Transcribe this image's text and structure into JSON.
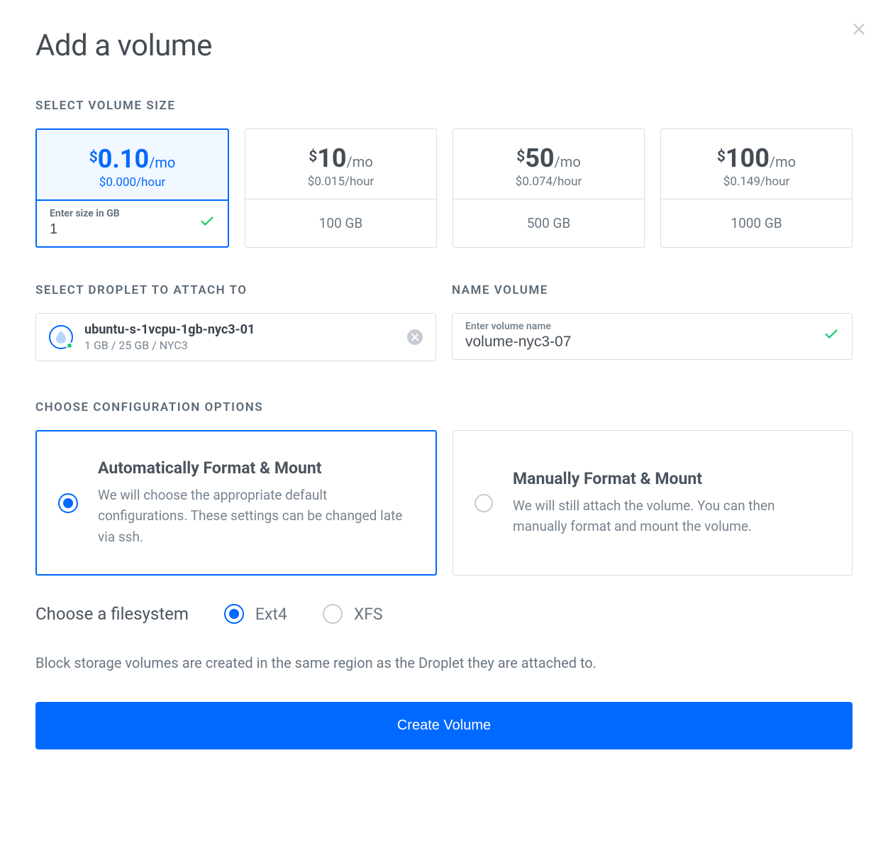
{
  "title": "Add a volume",
  "sections": {
    "size": "SELECT VOLUME SIZE",
    "droplet": "SELECT DROPLET TO ATTACH TO",
    "name": "NAME VOLUME",
    "config": "CHOOSE CONFIGURATION OPTIONS"
  },
  "sizes": [
    {
      "currency": "$",
      "amount": "0.10",
      "permo": "/mo",
      "sub": "$0.000/hour",
      "custom": true,
      "input_label": "Enter size in GB",
      "input_value": "1"
    },
    {
      "currency": "$",
      "amount": "10",
      "permo": "/mo",
      "sub": "$0.015/hour",
      "size": "100 GB"
    },
    {
      "currency": "$",
      "amount": "50",
      "permo": "/mo",
      "sub": "$0.074/hour",
      "size": "500 GB"
    },
    {
      "currency": "$",
      "amount": "100",
      "permo": "/mo",
      "sub": "$0.149/hour",
      "size": "1000 GB"
    }
  ],
  "droplet": {
    "name": "ubuntu-s-1vcpu-1gb-nyc3-01",
    "meta": "1 GB / 25 GB / NYC3"
  },
  "volume_name": {
    "label": "Enter volume name",
    "value": "volume-nyc3-07"
  },
  "config": [
    {
      "title": "Automatically Format & Mount",
      "desc": "We will choose the appropriate default configurations. These settings can be changed late via ssh."
    },
    {
      "title": "Manually Format & Mount",
      "desc": "We will still attach the volume. You can then manually format and mount the volume."
    }
  ],
  "filesystem": {
    "label": "Choose a filesystem",
    "options": [
      "Ext4",
      "XFS"
    ]
  },
  "note": "Block storage volumes are created in the same region as the Droplet they are attached to.",
  "create": "Create Volume"
}
